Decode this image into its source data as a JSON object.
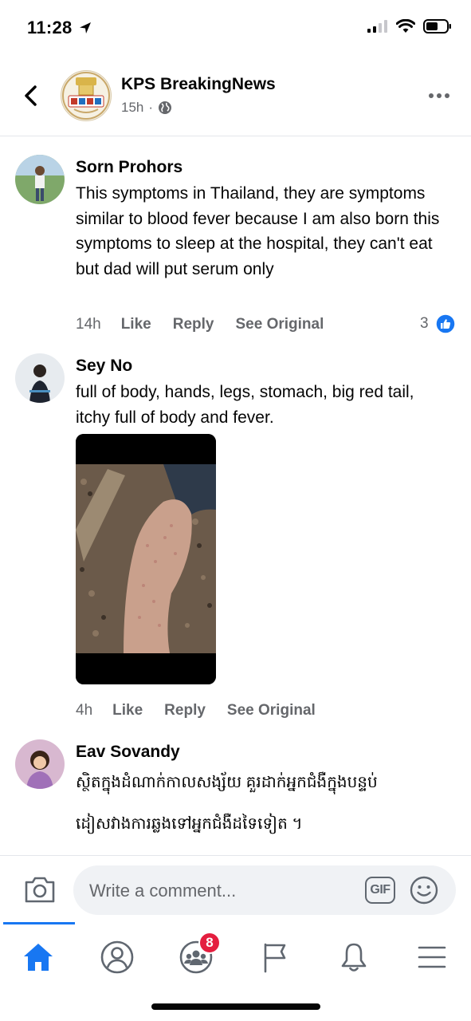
{
  "status_bar": {
    "time": "11:28"
  },
  "header": {
    "page_name": "KPS BreakingNews",
    "time": "15h",
    "separator": "·"
  },
  "comments": [
    {
      "author": "Sorn Prohors",
      "text": "This symptoms in Thailand, they are symptoms similar to blood fever because I am also born this symptoms to sleep at the hospital, they can't eat but dad will put serum only",
      "time": "14h",
      "like": "Like",
      "reply": "Reply",
      "see_original": "See Original",
      "reaction_count": "3"
    },
    {
      "author": "Sey No",
      "text": "full of body, hands, legs, stomach, big red tail, itchy full of body and fever.",
      "time": "4h",
      "like": "Like",
      "reply": "Reply",
      "see_original": "See Original"
    },
    {
      "author": "Eav Sovandy",
      "text_line1": "ស្ថិតក្នុងដំណាក់កាលសង្ស័យ គួរដាក់អ្នកជំងឺក្នុងបន្ទប់",
      "text_line2": "ដៀសវាងការឆ្លងទៅអ្នកជំងឺដទៃទៀត ។"
    }
  ],
  "composer": {
    "placeholder": "Write a comment...",
    "gif_label": "GIF"
  },
  "tabbar": {
    "groups_badge": "8"
  },
  "colors": {
    "accent": "#1877f2",
    "badge": "#e41e3f",
    "secondary_text": "#65676b"
  }
}
